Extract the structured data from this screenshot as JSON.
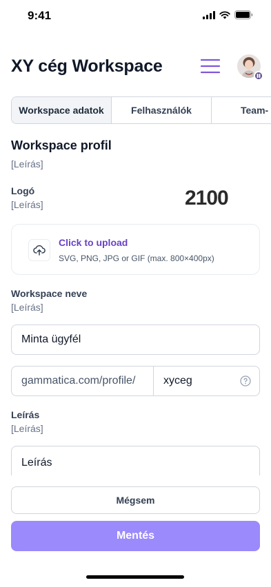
{
  "status_bar": {
    "time": "9:41"
  },
  "header": {
    "title": "XY cég Workspace"
  },
  "tabs": [
    {
      "label": "Workspace adatok",
      "active": true
    },
    {
      "label": "Felhasználók",
      "active": false
    },
    {
      "label": "Team-",
      "active": false
    }
  ],
  "profile": {
    "title": "Workspace profil",
    "description": "[Leírás]"
  },
  "logo": {
    "label": "Logó",
    "description": "[Leírás]",
    "current_logo_text": "2100"
  },
  "upload": {
    "link_text": "Click to upload",
    "hint": "SVG, PNG, JPG or GIF (max. 800×400px)"
  },
  "workspace_name": {
    "label": "Workspace neve",
    "description": "[Leírás]",
    "value": "Minta ügyfél"
  },
  "url": {
    "prefix": "gammatica.com/profile/",
    "slug": "xyceg"
  },
  "description_field": {
    "label": "Leírás",
    "description": "[Leírás]",
    "value": "Leírás"
  },
  "actions": {
    "cancel_label": "Mégsem",
    "save_label": "Mentés"
  },
  "colors": {
    "accent": "#6941c6",
    "save_button": "#9b8afb",
    "menu_icon": "#7f56d9"
  },
  "icons": [
    "signal-icon",
    "wifi-icon",
    "battery-icon",
    "hamburger-menu-icon",
    "upload-cloud-icon",
    "help-circle-icon"
  ]
}
